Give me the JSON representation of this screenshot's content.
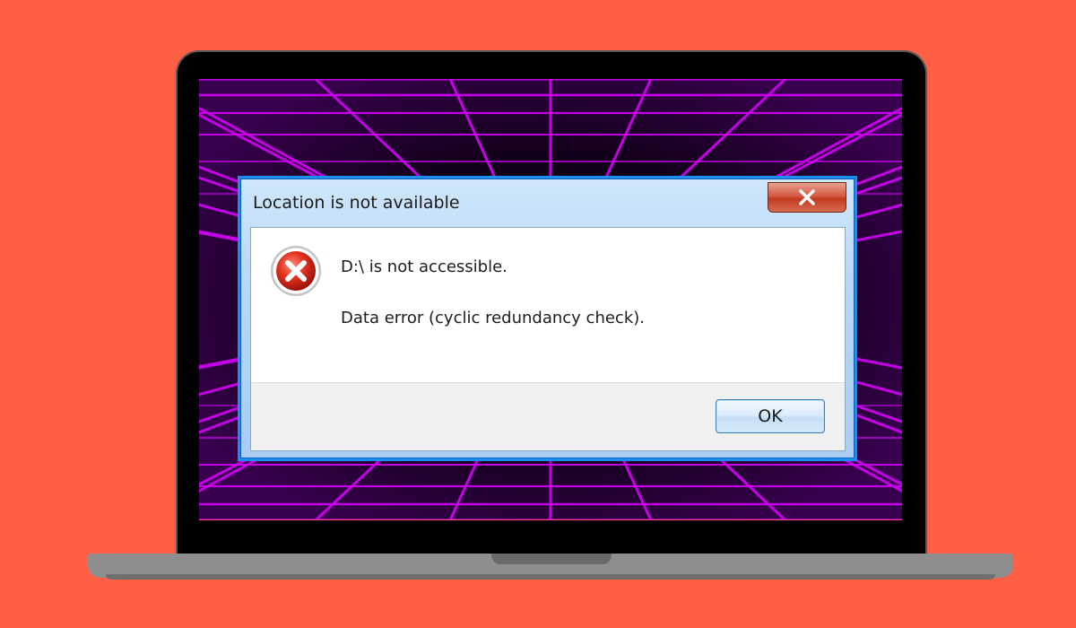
{
  "dialog": {
    "title": "Location is not available",
    "message": "D:\\ is not accessible.",
    "detail": "Data error (cyclic redundancy check).",
    "ok_label": "OK",
    "icon": "error-icon",
    "close_icon": "close-icon"
  },
  "colors": {
    "background": "#FF5F45",
    "grid_line": "#C400E6",
    "dialog_border": "#1C8CF0",
    "close_button": "#C9432B"
  }
}
